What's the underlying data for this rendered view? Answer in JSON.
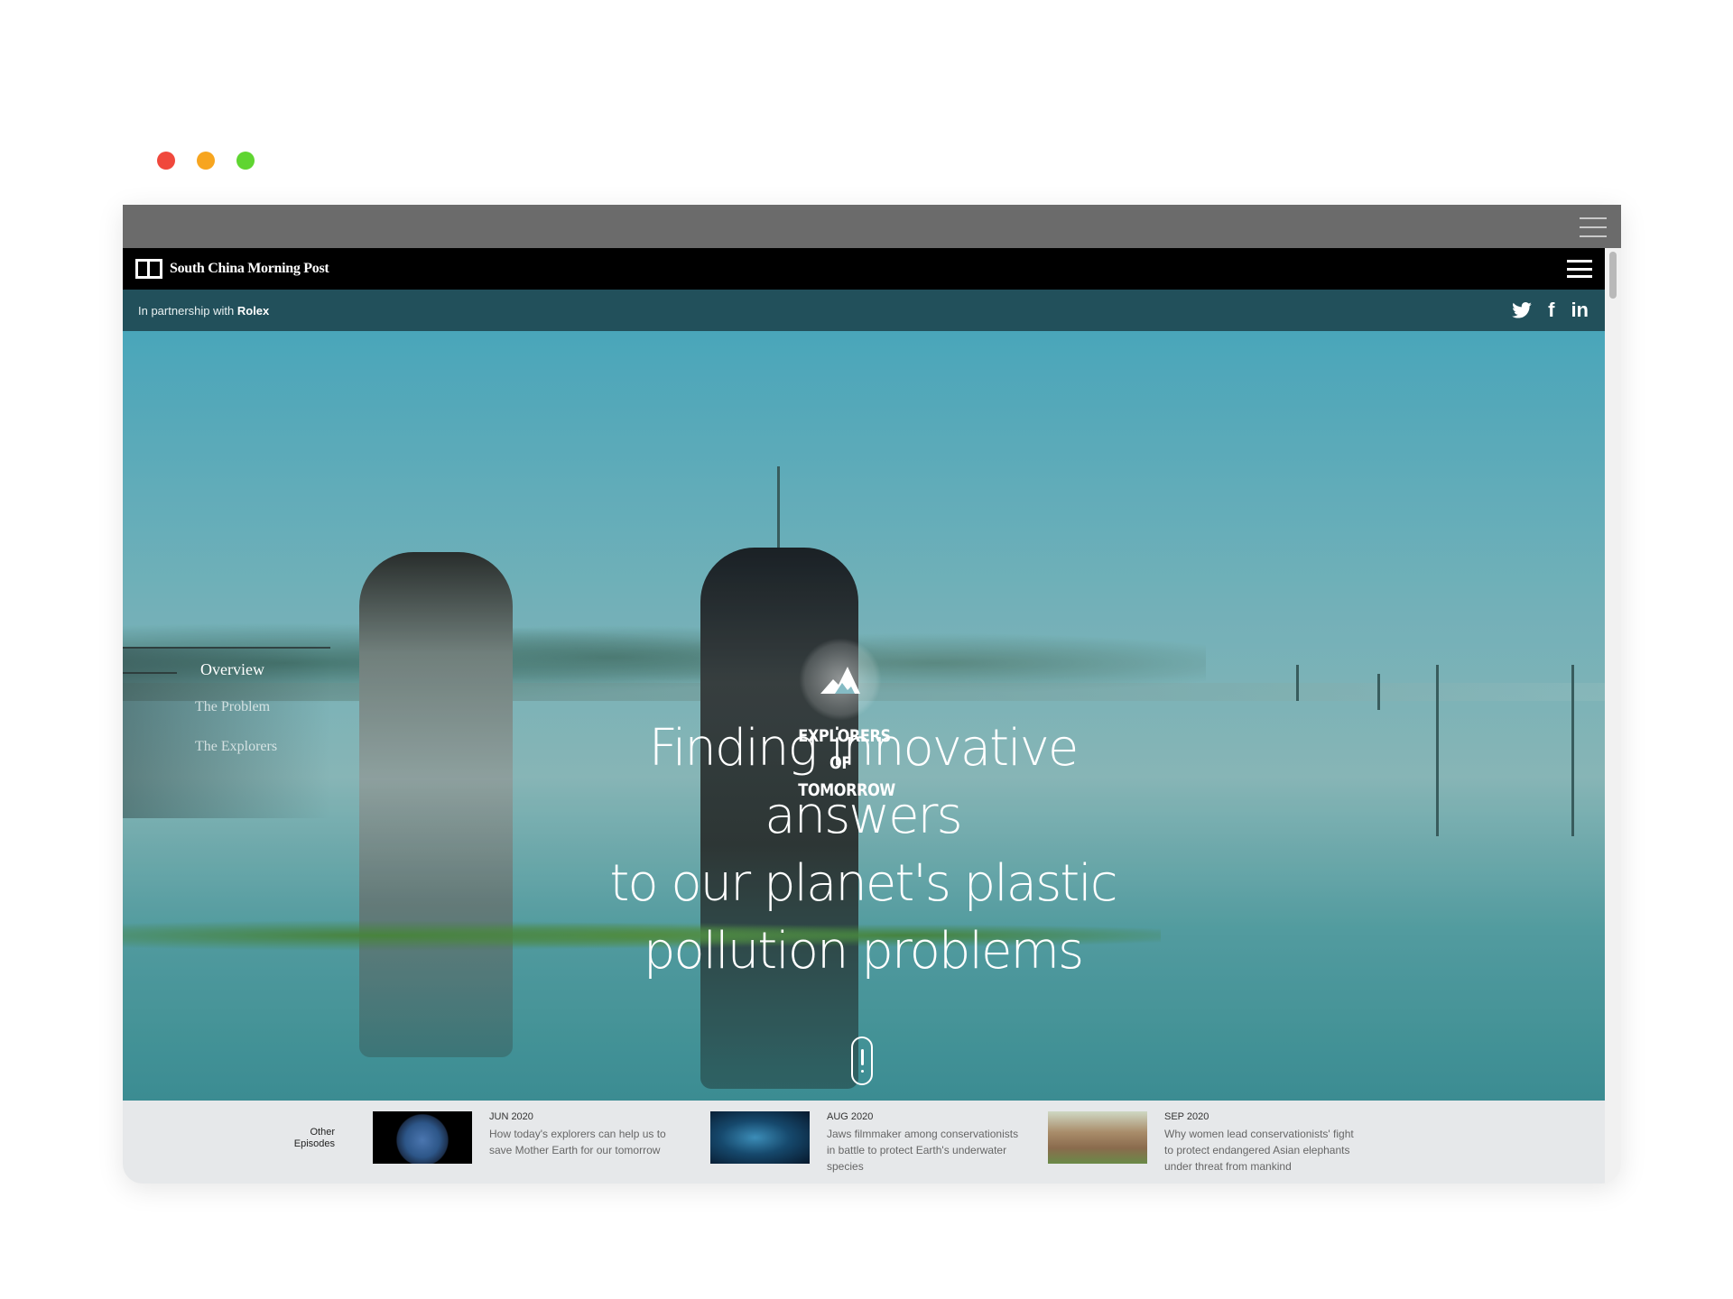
{
  "window_controls": [
    "close",
    "minimize",
    "maximize"
  ],
  "site": {
    "name": "South China Morning Post",
    "logo_icon": "scmp-logo-icon",
    "menu_icon": "hamburger-menu-icon"
  },
  "partner": {
    "prefix": "In partnership with",
    "name": "Rolex"
  },
  "social": [
    {
      "icon": "twitter-icon",
      "glyph": "🐦"
    },
    {
      "icon": "facebook-icon",
      "glyph": "f"
    },
    {
      "icon": "linkedin-icon",
      "glyph": "in"
    }
  ],
  "side_nav": {
    "items": [
      {
        "label": "Overview",
        "active": true
      },
      {
        "label": "The Problem",
        "active": false
      },
      {
        "label": "The Explorers",
        "active": false
      }
    ]
  },
  "badge": {
    "line1": "EXPLORERS OF",
    "line2": "TOMORROW"
  },
  "hero": {
    "line1": "Finding innovative answers",
    "line2": "to our planet's plastic",
    "line3": "pollution problems"
  },
  "episodes": {
    "label_line1": "Other",
    "label_line2": "Episodes",
    "items": [
      {
        "date": "JUN 2020",
        "title": "How today's explorers can help us to save Mother Earth for our tomorrow",
        "thumb": "earth"
      },
      {
        "date": "AUG 2020",
        "title": "Jaws filmmaker among conservationists in battle to protect Earth's underwater species",
        "thumb": "ocean"
      },
      {
        "date": "SEP 2020",
        "title": "Why women lead conservationists' fight to protect endangered Asian elephants under threat from mankind",
        "thumb": "elephant"
      }
    ]
  },
  "colors": {
    "nav_bg": "#000000",
    "partner_bar": "#22505b",
    "chrome": "#6b6b6b",
    "episodes_bg": "#e6e8ea"
  }
}
